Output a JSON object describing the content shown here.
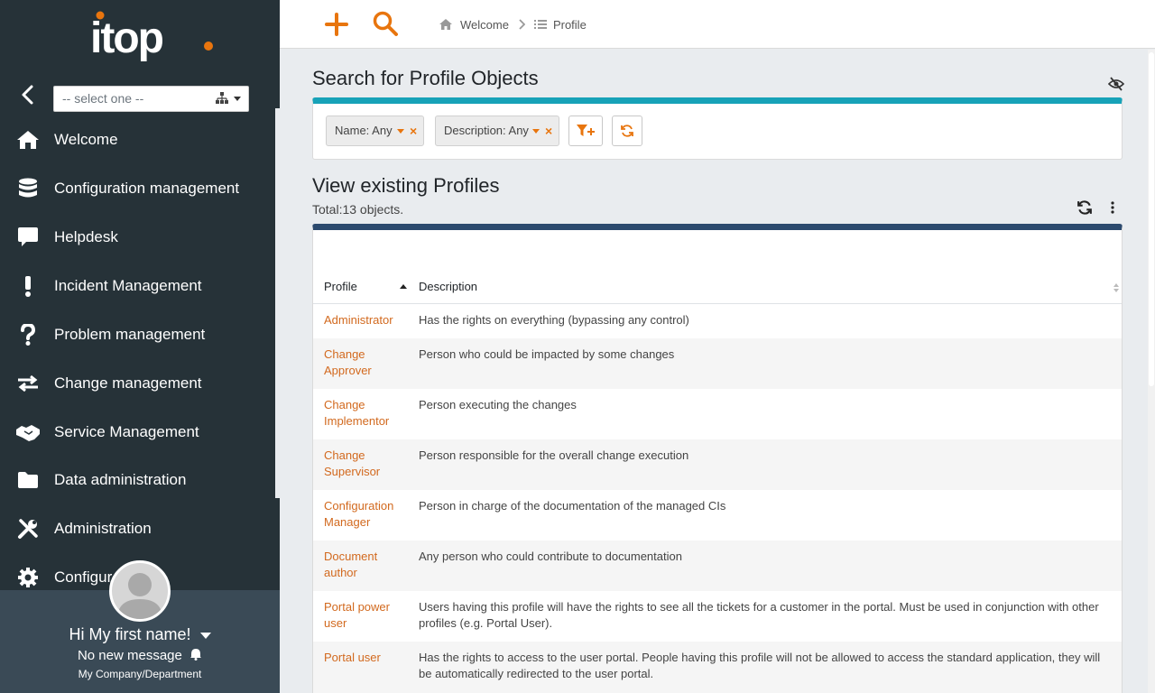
{
  "app": {
    "logo_text": "itop",
    "brand_color": "#e8750e",
    "sidebar_color": "#263238"
  },
  "sidebar": {
    "org_select": {
      "value": "-- select one --"
    },
    "menu": [
      {
        "label": "Welcome",
        "icon": "home-icon"
      },
      {
        "label": "Configuration management",
        "icon": "database-icon"
      },
      {
        "label": "Helpdesk",
        "icon": "comment-icon"
      },
      {
        "label": "Incident Management",
        "icon": "exclamation-icon"
      },
      {
        "label": "Problem management",
        "icon": "question-icon"
      },
      {
        "label": "Change management",
        "icon": "exchange-icon"
      },
      {
        "label": "Service Management",
        "icon": "handshake-icon"
      },
      {
        "label": "Data administration",
        "icon": "folder-icon"
      },
      {
        "label": "Administration",
        "icon": "tools-icon"
      },
      {
        "label": "Configur",
        "icon": "gear-icon"
      }
    ]
  },
  "user": {
    "greeting": "Hi My first name!",
    "messages": "No new message",
    "org": "My Company/Department"
  },
  "breadcrumb": {
    "items": [
      "Welcome",
      "Profile"
    ]
  },
  "search": {
    "title": "Search for Profile Objects",
    "criteria": [
      {
        "label": "Name: Any"
      },
      {
        "label": "Description: Any"
      }
    ]
  },
  "list": {
    "title": "View existing Profiles",
    "total": "Total:13 objects.",
    "columns": [
      "Profile",
      "Description"
    ],
    "rows": [
      {
        "profile": "Administrator",
        "description": "Has the rights on everything (bypassing any control)"
      },
      {
        "profile": "Change Approver",
        "description": "Person who could be impacted by some changes"
      },
      {
        "profile": "Change Implementor",
        "description": "Person executing the changes"
      },
      {
        "profile": "Change Supervisor",
        "description": "Person responsible for the overall change execution"
      },
      {
        "profile": "Configuration Manager",
        "description": "Person in charge of the documentation of the managed CIs"
      },
      {
        "profile": "Document author",
        "description": "Any person who could contribute to documentation"
      },
      {
        "profile": "Portal power user",
        "description": "Users having this profile will have the rights to see all the tickets for a customer in the portal. Must be used in conjunction with other profiles (e.g. Portal User)."
      },
      {
        "profile": "Portal user",
        "description": "Has the rights to access to the user portal. People having this profile will not be allowed to access the standard application, they will be automatically redirected to the user portal."
      }
    ]
  }
}
